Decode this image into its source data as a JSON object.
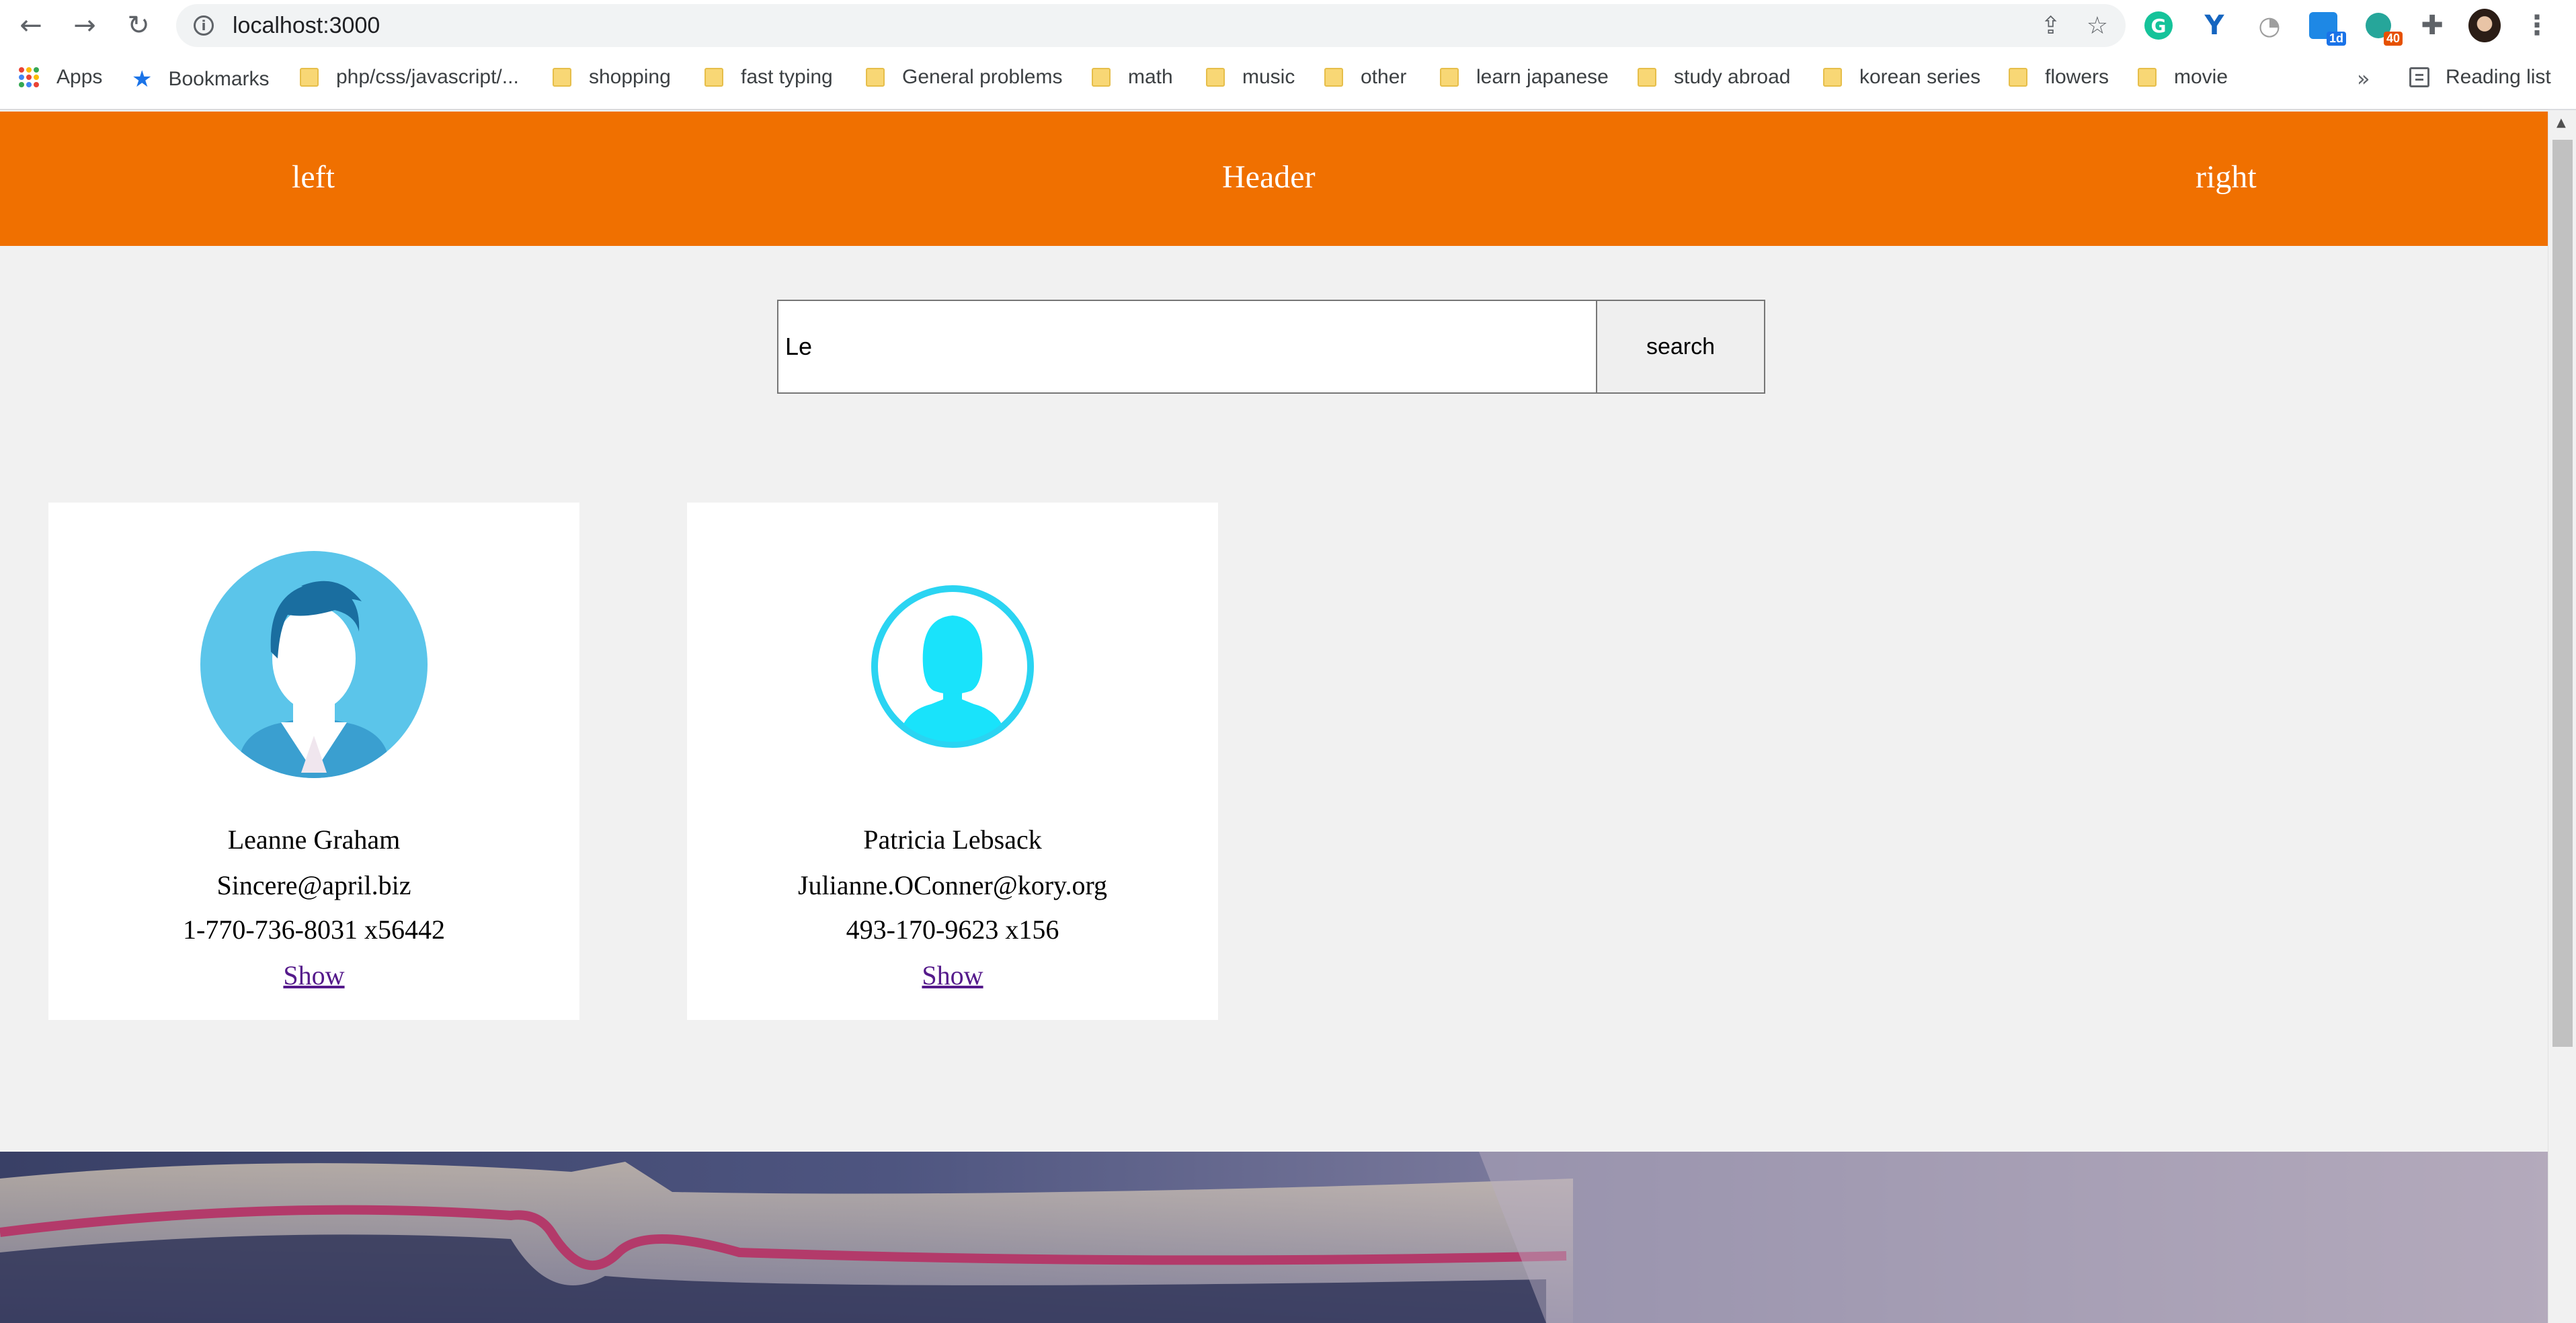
{
  "browser": {
    "url": "localhost:3000",
    "nav": {
      "back": "←",
      "forward": "→",
      "reload": "↻"
    },
    "omnibox_icons": [
      "share-icon",
      "star-icon"
    ],
    "extensions": [
      {
        "name": "grammarly-icon",
        "label": "G"
      },
      {
        "name": "vpn-icon",
        "label": "Y"
      },
      {
        "name": "timer-icon",
        "label": ""
      },
      {
        "name": "calendar-icon",
        "badge": "1d"
      },
      {
        "name": "tracker-icon",
        "badge": "40"
      },
      {
        "name": "puzzle-icon",
        "label": "✚"
      },
      {
        "name": "avatar-icon",
        "label": ""
      },
      {
        "name": "menu-icon",
        "label": "⋮"
      }
    ]
  },
  "bookmarks": {
    "apps": "Apps",
    "bookmarks": "Bookmarks",
    "folders": [
      "php/css/javascript/...",
      "shopping",
      "fast typing",
      "General problems",
      "math",
      "music",
      "other",
      "learn japanese",
      "study abroad",
      "korean series",
      "flowers",
      "movie"
    ],
    "overflow": "»",
    "reading_list": "Reading list"
  },
  "header": {
    "left": "left",
    "title": "Header",
    "right": "right",
    "color": "#f07000"
  },
  "search": {
    "value": "Le",
    "button": "search"
  },
  "users": [
    {
      "name": "Leanne Graham",
      "email": "Sincere@april.biz",
      "phone": "1-770-736-8031 x56442",
      "link": "Show",
      "avatar": "male-avatar-icon"
    },
    {
      "name": "Patricia Lebsack",
      "email": "Julianne.OConner@kory.org",
      "phone": "493-170-9623 x156",
      "link": "Show",
      "avatar": "female-avatar-icon"
    }
  ]
}
